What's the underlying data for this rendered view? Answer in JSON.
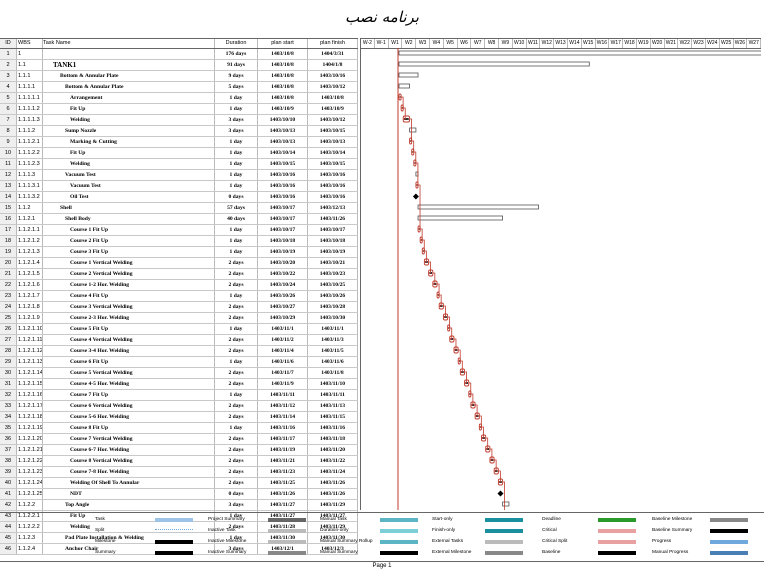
{
  "title": "برنامه نصب",
  "headers": {
    "id": "ID",
    "wbs": "WBS",
    "name": "Task Name",
    "duration": "Duration",
    "start": "plan start",
    "finish": "plan finish"
  },
  "weeks": [
    "W-2",
    "W-1",
    "W1",
    "W2",
    "W3",
    "W4",
    "W5",
    "W6",
    "W7",
    "W8",
    "W9",
    "W10",
    "W11",
    "W12",
    "W13",
    "W14",
    "W15",
    "W16",
    "W17",
    "W18",
    "W19",
    "W20",
    "W21",
    "W22",
    "W23",
    "W24",
    "W25",
    "W26",
    "W27"
  ],
  "rows": [
    {
      "id": "1",
      "wbs": "1",
      "name": "",
      "duration": "176 days",
      "start": "1403/10/8",
      "finish": "1404/3/31"
    },
    {
      "id": "2",
      "wbs": "1.1",
      "name": "TANK1",
      "duration": "91 days",
      "start": "1403/10/8",
      "finish": "1404/1/8"
    },
    {
      "id": "3",
      "wbs": "1.1.1",
      "name": "Bottom & Annular Plate",
      "duration": "9 days",
      "start": "1403/10/8",
      "finish": "1403/10/16"
    },
    {
      "id": "4",
      "wbs": "1.1.1.1",
      "name": "Bottom & Annular Plate",
      "duration": "5 days",
      "start": "1403/10/8",
      "finish": "1403/10/12"
    },
    {
      "id": "5",
      "wbs": "1.1.1.1.1",
      "name": "Arrangement",
      "duration": "1 day",
      "start": "1403/10/8",
      "finish": "1403/10/8"
    },
    {
      "id": "6",
      "wbs": "1.1.1.1.2",
      "name": "Fit Up",
      "duration": "1 day",
      "start": "1403/10/9",
      "finish": "1403/10/9"
    },
    {
      "id": "7",
      "wbs": "1.1.1.1.3",
      "name": "Welding",
      "duration": "3 days",
      "start": "1403/10/10",
      "finish": "1403/10/12"
    },
    {
      "id": "8",
      "wbs": "1.1.1.2",
      "name": "Sump Nozzle",
      "duration": "3 days",
      "start": "1403/10/13",
      "finish": "1403/10/15"
    },
    {
      "id": "9",
      "wbs": "1.1.1.2.1",
      "name": "Marking & Cutting",
      "duration": "1 day",
      "start": "1403/10/13",
      "finish": "1403/10/13"
    },
    {
      "id": "10",
      "wbs": "1.1.1.2.2",
      "name": "Fit Up",
      "duration": "1 day",
      "start": "1403/10/14",
      "finish": "1403/10/14"
    },
    {
      "id": "11",
      "wbs": "1.1.1.2.3",
      "name": "Welding",
      "duration": "1 day",
      "start": "1403/10/15",
      "finish": "1403/10/15"
    },
    {
      "id": "12",
      "wbs": "1.1.1.3",
      "name": "Vacuum Test",
      "duration": "1 day",
      "start": "1403/10/16",
      "finish": "1403/10/16"
    },
    {
      "id": "13",
      "wbs": "1.1.1.3.1",
      "name": "Vacuum Test",
      "duration": "1 day",
      "start": "1403/10/16",
      "finish": "1403/10/16"
    },
    {
      "id": "14",
      "wbs": "1.1.1.3.2",
      "name": "Oil Test",
      "duration": "0 days",
      "start": "1403/10/16",
      "finish": "1403/10/16"
    },
    {
      "id": "15",
      "wbs": "1.1.2",
      "name": "Shell",
      "duration": "57 days",
      "start": "1403/10/17",
      "finish": "1403/12/13"
    },
    {
      "id": "16",
      "wbs": "1.1.2.1",
      "name": "Shell Body",
      "duration": "40 days",
      "start": "1403/10/17",
      "finish": "1403/11/26"
    },
    {
      "id": "17",
      "wbs": "1.1.2.1.1",
      "name": "Course 1 Fit Up",
      "duration": "1 day",
      "start": "1403/10/17",
      "finish": "1403/10/17"
    },
    {
      "id": "18",
      "wbs": "1.1.2.1.2",
      "name": "Course 2 Fit Up",
      "duration": "1 day",
      "start": "1403/10/18",
      "finish": "1403/10/18"
    },
    {
      "id": "19",
      "wbs": "1.1.2.1.3",
      "name": "Course 3 Fit Up",
      "duration": "1 day",
      "start": "1403/10/19",
      "finish": "1403/10/19"
    },
    {
      "id": "20",
      "wbs": "1.1.2.1.4",
      "name": "Course 1 Vertical Welding",
      "duration": "2 days",
      "start": "1403/10/20",
      "finish": "1403/10/21"
    },
    {
      "id": "21",
      "wbs": "1.1.2.1.5",
      "name": "Course 2 Vertical Welding",
      "duration": "2 days",
      "start": "1403/10/22",
      "finish": "1403/10/23"
    },
    {
      "id": "22",
      "wbs": "1.1.2.1.6",
      "name": "Course 1-2 Hor. Welding",
      "duration": "2 days",
      "start": "1403/10/24",
      "finish": "1403/10/25"
    },
    {
      "id": "23",
      "wbs": "1.1.2.1.7",
      "name": "Course 4 Fit Up",
      "duration": "1 day",
      "start": "1403/10/26",
      "finish": "1403/10/26"
    },
    {
      "id": "24",
      "wbs": "1.1.2.1.8",
      "name": "Course 3 Vertical Welding",
      "duration": "2 days",
      "start": "1403/10/27",
      "finish": "1403/10/28"
    },
    {
      "id": "25",
      "wbs": "1.1.2.1.9",
      "name": "Course 2-3 Hor. Welding",
      "duration": "2 days",
      "start": "1403/10/29",
      "finish": "1403/10/30"
    },
    {
      "id": "26",
      "wbs": "1.1.2.1.10",
      "name": "Course 5 Fit Up",
      "duration": "1 day",
      "start": "1403/11/1",
      "finish": "1403/11/1"
    },
    {
      "id": "27",
      "wbs": "1.1.2.1.11",
      "name": "Course 4 Vertical Welding",
      "duration": "2 days",
      "start": "1403/11/2",
      "finish": "1403/11/3"
    },
    {
      "id": "28",
      "wbs": "1.1.2.1.12",
      "name": "Course 3-4 Hor. Welding",
      "duration": "2 days",
      "start": "1403/11/4",
      "finish": "1403/11/5"
    },
    {
      "id": "29",
      "wbs": "1.1.2.1.13",
      "name": "Course 6 Fit Up",
      "duration": "1 day",
      "start": "1403/11/6",
      "finish": "1403/11/6"
    },
    {
      "id": "30",
      "wbs": "1.1.2.1.14",
      "name": "Course 5 Vertical Welding",
      "duration": "2 days",
      "start": "1403/11/7",
      "finish": "1403/11/8"
    },
    {
      "id": "31",
      "wbs": "1.1.2.1.15",
      "name": "Course 4-5 Hor. Welding",
      "duration": "2 days",
      "start": "1403/11/9",
      "finish": "1403/11/10"
    },
    {
      "id": "32",
      "wbs": "1.1.2.1.16",
      "name": "Course 7 Fit Up",
      "duration": "1 day",
      "start": "1403/11/11",
      "finish": "1403/11/11"
    },
    {
      "id": "33",
      "wbs": "1.1.2.1.17",
      "name": "Course 6 Vertical Welding",
      "duration": "2 days",
      "start": "1403/11/12",
      "finish": "1403/11/13"
    },
    {
      "id": "34",
      "wbs": "1.1.2.1.18",
      "name": "Course 5-6 Hor. Welding",
      "duration": "2 days",
      "start": "1403/11/14",
      "finish": "1403/11/15"
    },
    {
      "id": "35",
      "wbs": "1.1.2.1.19",
      "name": "Course 8 Fit Up",
      "duration": "1 day",
      "start": "1403/11/16",
      "finish": "1403/11/16"
    },
    {
      "id": "36",
      "wbs": "1.1.2.1.20",
      "name": "Course 7 Vertical Welding",
      "duration": "2 days",
      "start": "1403/11/17",
      "finish": "1403/11/18"
    },
    {
      "id": "37",
      "wbs": "1.1.2.1.21",
      "name": "Course 6-7 Hor. Welding",
      "duration": "2 days",
      "start": "1403/11/19",
      "finish": "1403/11/20"
    },
    {
      "id": "38",
      "wbs": "1.1.2.1.22",
      "name": "Course 8 Vertical Welding",
      "duration": "2 days",
      "start": "1403/11/21",
      "finish": "1403/11/22"
    },
    {
      "id": "39",
      "wbs": "1.1.2.1.23",
      "name": "Course 7-8 Hor. Welding",
      "duration": "2 days",
      "start": "1403/11/23",
      "finish": "1403/11/24"
    },
    {
      "id": "40",
      "wbs": "1.1.2.1.24",
      "name": "Welding Of Shell To Annular",
      "duration": "2 days",
      "start": "1403/11/25",
      "finish": "1403/11/26"
    },
    {
      "id": "41",
      "wbs": "1.1.2.1.25",
      "name": "NDT",
      "duration": "0 days",
      "start": "1403/11/26",
      "finish": "1403/11/26"
    },
    {
      "id": "42",
      "wbs": "1.1.2.2",
      "name": "Top Angle",
      "duration": "3 days",
      "start": "1403/11/27",
      "finish": "1403/11/29"
    },
    {
      "id": "43",
      "wbs": "1.1.2.2.1",
      "name": "Fit Up",
      "duration": "1 day",
      "start": "1403/11/27",
      "finish": "1403/11/27"
    },
    {
      "id": "44",
      "wbs": "1.1.2.2.2",
      "name": "Welding",
      "duration": "2 days",
      "start": "1403/11/28",
      "finish": "1403/11/29"
    },
    {
      "id": "45",
      "wbs": "1.1.2.3",
      "name": "Pad Plate Installation & Welding",
      "duration": "1 day",
      "start": "1403/11/30",
      "finish": "1403/11/30"
    },
    {
      "id": "46",
      "wbs": "1.1.2.4",
      "name": "Anchor Chair",
      "duration": "3 days",
      "start": "1403/12/1",
      "finish": "1403/12/3"
    }
  ],
  "legend": {
    "col1": [
      "Task",
      "Split",
      "Milestone",
      "Summary"
    ],
    "col2": [
      "Project Summary",
      "Inactive Task",
      "Inactive Milestone",
      "Inactive Summary"
    ],
    "col3": [
      "Manual Task",
      "Duration-only",
      "Manual Summary Rollup",
      "Manual Summary"
    ],
    "col4": [
      "Start-only",
      "Finish-only",
      "External Tasks",
      "External Milestone"
    ],
    "col5": [
      "Deadline",
      "Critical",
      "Critical Split",
      "Baseline"
    ],
    "col6": [
      "Baseline Milestone",
      "Baseline Summary",
      "Progress",
      "Manual Progress"
    ]
  },
  "footer": "Page 1",
  "colors": {
    "critical": "#c0392b",
    "task": "#9dc3e6",
    "baseline": "#e8a0a0",
    "summary": "#555555"
  }
}
